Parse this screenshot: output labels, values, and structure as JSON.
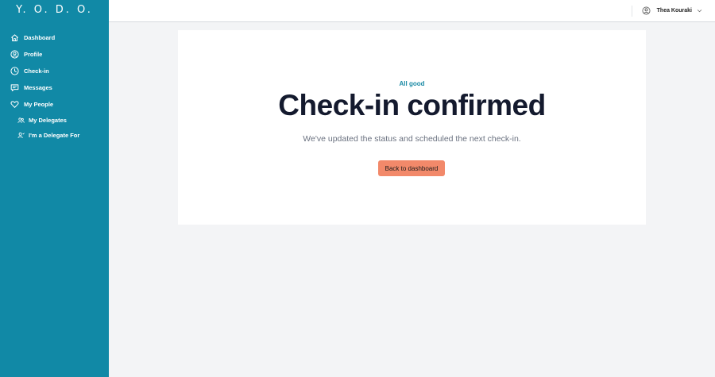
{
  "sidebar": {
    "brand": "Y. O. D. O.",
    "items": [
      {
        "label": "Dashboard",
        "icon": "home-icon"
      },
      {
        "label": "Profile",
        "icon": "user-circle-icon"
      },
      {
        "label": "Check-in",
        "icon": "clock-icon"
      },
      {
        "label": "Messages",
        "icon": "chat-icon"
      },
      {
        "label": "My People",
        "icon": "heart-icon"
      }
    ],
    "subitems": [
      {
        "label": "My Delegates",
        "icon": "people-icon"
      },
      {
        "label": "I'm a Delegate For",
        "icon": "person-icon"
      }
    ]
  },
  "header": {
    "user_name": "Thea Kouraki",
    "user_icon": "user-circle-icon",
    "dropdown_icon": "chevron-down-icon"
  },
  "main": {
    "eyebrow": "All good",
    "title": "Check-in confirmed",
    "subtitle": "We've updated the status and scheduled the next check-in.",
    "cta_label": "Back to dashboard"
  },
  "colors": {
    "sidebar": "#1189a6",
    "accent": "#1a8aa5",
    "cta": "#f2896a",
    "title": "#141a2e"
  }
}
